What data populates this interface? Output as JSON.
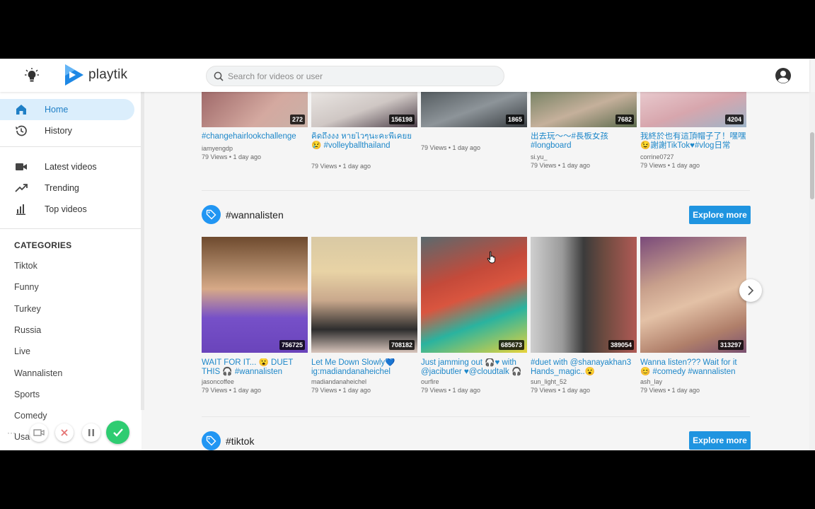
{
  "app": {
    "name": "playtik"
  },
  "search": {
    "placeholder": "Search for videos or user"
  },
  "sidebar": {
    "nav": [
      {
        "label": "Home",
        "icon": "home-icon",
        "active": true
      },
      {
        "label": "History",
        "icon": "history-icon"
      },
      {
        "label": "Latest videos",
        "icon": "video-camera-icon"
      },
      {
        "label": "Trending",
        "icon": "trending-icon"
      },
      {
        "label": "Top videos",
        "icon": "bar-chart-icon"
      }
    ],
    "categories_title": "CATEGORIES",
    "categories": [
      "Tiktok",
      "Funny",
      "Turkey",
      "Russia",
      "Live",
      "Wannalisten",
      "Sports",
      "Comedy",
      "Usa"
    ]
  },
  "sections": [
    {
      "title": "",
      "videos": [
        {
          "title": "#changehairlookchallenge",
          "user": "iamyengdp",
          "meta": "79 Views • 1 day ago",
          "count": "272"
        },
        {
          "title": "คิดถึงงง หายไวๆนะคะพี่เคยย😢 #volleyballthailand",
          "user": "",
          "meta": "79 Views • 1 day ago",
          "count": "156198"
        },
        {
          "title": "",
          "user": "",
          "meta": "79 Views • 1 day ago",
          "count": "1865"
        },
        {
          "title": "出去玩～～#長板女孩 #longboard",
          "user": "si.yu_",
          "meta": "79 Views • 1 day ago",
          "count": "7682"
        },
        {
          "title": "我終於也有這頂帽子了！嘿嘿😉謝謝TikTok♥#vlog日常",
          "user": "corrine0727",
          "meta": "79 Views • 1 day ago",
          "count": "4204"
        }
      ]
    },
    {
      "title": "#wannalisten",
      "explore": "Explore more",
      "videos": [
        {
          "title": "WAIT FOR IT... 😮 DUET THIS 🎧 #wannalisten",
          "user": "jasoncoffee",
          "meta": "79 Views • 1 day ago",
          "count": "756725"
        },
        {
          "title": "Let Me Down Slowly💙 ig:madiandanaheichel",
          "user": "madiandanaheichel",
          "meta": "79 Views • 1 day ago",
          "count": "708182"
        },
        {
          "title": "Just jamming out 🎧♥ with @jacibutler ♥@cloudtalk 🎧",
          "user": "ourfire",
          "meta": "79 Views • 1 day ago",
          "count": "685673"
        },
        {
          "title": "#duet with @shanayakhan3 Hands_magic..😮",
          "user": "sun_light_52",
          "meta": "79 Views • 1 day ago",
          "count": "389054"
        },
        {
          "title": "Wanna listen??? Wait for it 😊 #comedy #wannalisten",
          "user": "ash_lay",
          "meta": "79 Views • 1 day ago",
          "count": "313297"
        }
      ]
    },
    {
      "title": "#tiktok",
      "explore": "Explore more"
    }
  ],
  "colors": {
    "accent": "#2196f3",
    "link": "#1d87c9",
    "button": "#1f94e0",
    "active_bg": "#dbeefc"
  }
}
